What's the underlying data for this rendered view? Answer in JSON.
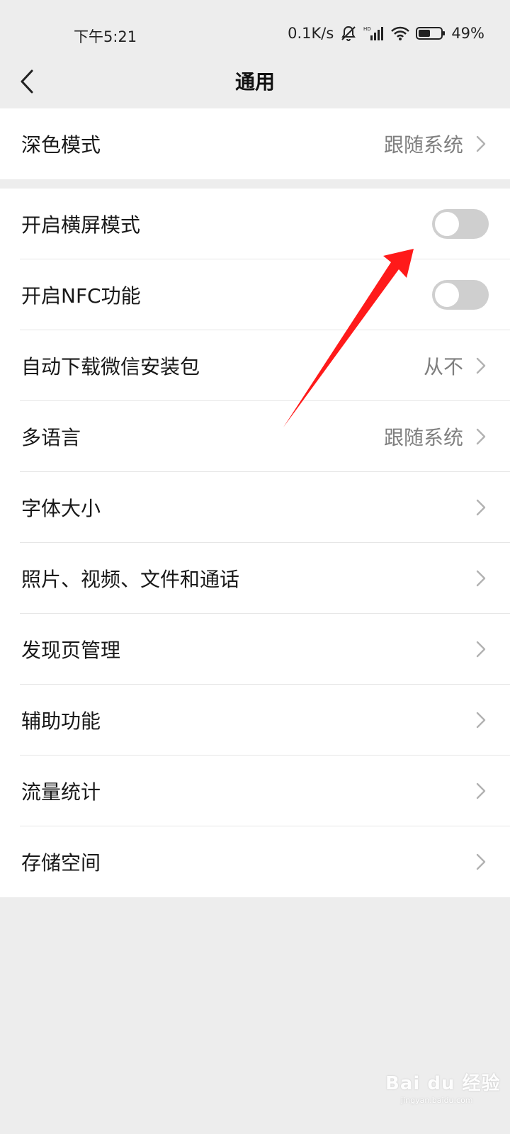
{
  "status_bar": {
    "time": "下午5:21",
    "net_speed": "0.1K/s",
    "battery": "49%"
  },
  "nav": {
    "title": "通用"
  },
  "group1": [
    {
      "label": "深色模式",
      "value": "跟随系统",
      "type": "link"
    }
  ],
  "group2": [
    {
      "label": "开启横屏模式",
      "type": "toggle",
      "on": false
    },
    {
      "label": "开启NFC功能",
      "type": "toggle",
      "on": false
    },
    {
      "label": "自动下载微信安装包",
      "value": "从不",
      "type": "link"
    },
    {
      "label": "多语言",
      "value": "跟随系统",
      "type": "link"
    },
    {
      "label": "字体大小",
      "type": "link"
    },
    {
      "label": "照片、视频、文件和通话",
      "type": "link"
    },
    {
      "label": "发现页管理",
      "type": "link"
    },
    {
      "label": "辅助功能",
      "type": "link"
    },
    {
      "label": "流量统计",
      "type": "link"
    },
    {
      "label": "存储空间",
      "type": "link"
    }
  ],
  "watermark": {
    "text": "Bai du 经验",
    "sub": "jingyan.baidu.com"
  },
  "colors": {
    "background": "#ededed",
    "toggle_off": "#cfcfcf",
    "annotation_arrow": "#ff1a1a"
  }
}
